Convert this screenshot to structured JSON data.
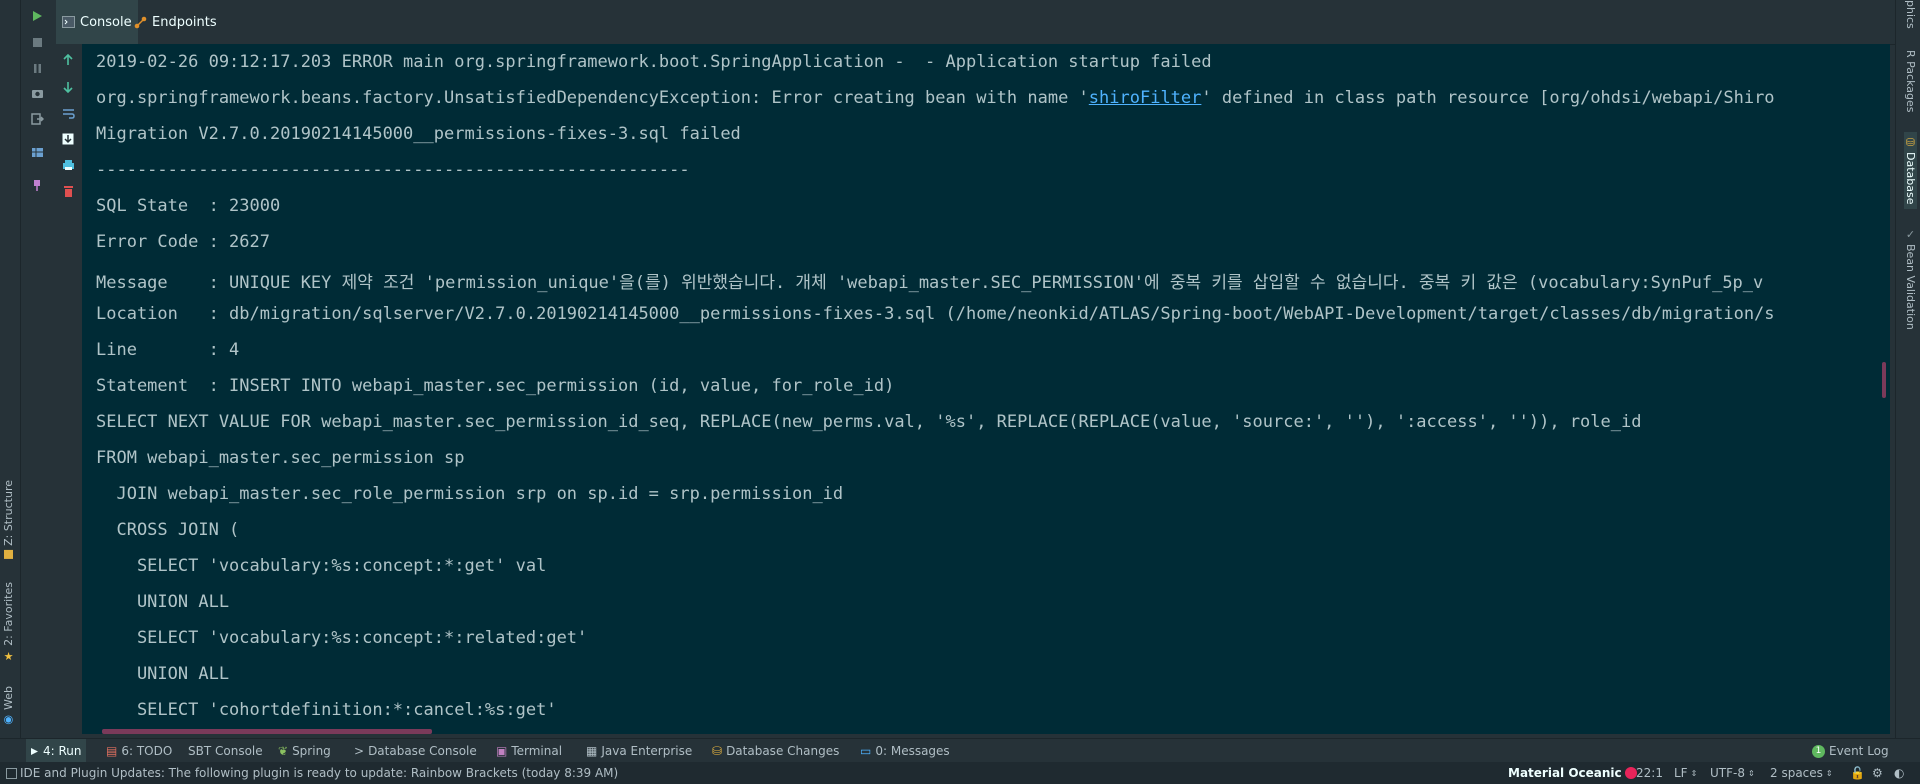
{
  "left_strip": {
    "structure": "Z: Structure",
    "favorites": "2: Favorites",
    "web": "Web"
  },
  "tabs": [
    {
      "label": "Console",
      "active": true
    },
    {
      "label": "Endpoints",
      "active": false
    }
  ],
  "console": {
    "lines": [
      "2019-02-26 09:12:17.203 ERROR main org.springframework.boot.SpringApplication -  - Application startup failed",
      "org.springframework.beans.factory.UnsatisfiedDependencyException: Error creating bean with name '",
      "Migration V2.7.0.20190214145000__permissions-fixes-3.sql failed",
      "----------------------------------------------------------",
      "SQL State  : 23000",
      "Error Code : 2627",
      "Message    : UNIQUE KEY 제약 조건 'permission_unique'을(를) 위반했습니다. 개체 'webapi_master.SEC_PERMISSION'에 중복 키를 삽입할 수 없습니다. 중복 키 값은 (vocabulary:SynPuf_5p_v",
      "Location   : db/migration/sqlserver/V2.7.0.20190214145000__permissions-fixes-3.sql (/home/neonkid/ATLAS/Spring-boot/WebAPI-Development/target/classes/db/migration/s",
      "Line       : 4",
      "Statement  : INSERT INTO webapi_master.sec_permission (id, value, for_role_id)",
      "SELECT NEXT VALUE FOR webapi_master.sec_permission_id_seq, REPLACE(new_perms.val, '%s', REPLACE(REPLACE(value, 'source:', ''), ':access', '')), role_id",
      "FROM webapi_master.sec_permission sp",
      "  JOIN webapi_master.sec_role_permission srp on sp.id = srp.permission_id",
      "  CROSS JOIN (",
      "    SELECT 'vocabulary:%s:concept:*:get' val",
      "    UNION ALL",
      "    SELECT 'vocabulary:%s:concept:*:related:get'",
      "    UNION ALL",
      "    SELECT 'cohortdefinition:*:cancel:%s:get'"
    ],
    "line2_link": "shiroFilter",
    "line2_suffix": "' defined in class path resource [org/ohdsi/webapi/Shiro"
  },
  "right_strip": {
    "graphics": "phics",
    "r_packages": "R Packages",
    "database": "Database",
    "bean_validation": "Bean Validation"
  },
  "bottom_tabs": [
    {
      "label": "4: Run",
      "active": true
    },
    {
      "label": "6: TODO",
      "active": false
    },
    {
      "label": "SBT Console",
      "active": false
    },
    {
      "label": "Spring",
      "active": false
    },
    {
      "label": "Database Console",
      "active": false
    },
    {
      "label": "Terminal",
      "active": false
    },
    {
      "label": "Java Enterprise",
      "active": false
    },
    {
      "label": "Database Changes",
      "active": false
    },
    {
      "label": "0: Messages",
      "active": false
    }
  ],
  "event_log": "Event Log",
  "event_log_badge": "1",
  "status": {
    "message": "IDE and Plugin Updates: The following plugin is ready to update: Rainbow Brackets (today 8:39 AM)",
    "theme": "Material Oceanic",
    "position": "22:1",
    "line_sep": "LF",
    "encoding": "UTF-8",
    "indent": "2 spaces"
  },
  "colors": {
    "console_bg": "#002b36",
    "panel_bg": "#263238",
    "link": "#4fb3ff",
    "accent": "#e8245a"
  }
}
